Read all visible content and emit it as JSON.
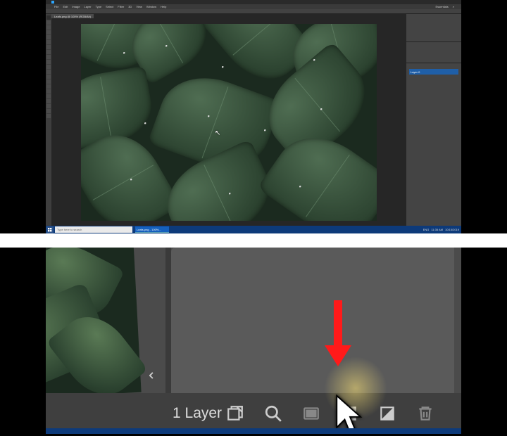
{
  "app": {
    "menus": [
      "File",
      "Edit",
      "Image",
      "Layer",
      "Type",
      "Select",
      "Filter",
      "3D",
      "View",
      "Window",
      "Help"
    ],
    "right_menus": [
      "Essentials"
    ],
    "doc_tab": "Leafs.png @ 100% (RGB/8#)"
  },
  "layers_panel": {
    "active_layer": "Layer 0"
  },
  "taskbar": {
    "search_placeholder": "Type here to search",
    "app_button": "Leafs.png - 100%...",
    "time": "11:35 AM",
    "date": "10/15/2019",
    "lang": "ENG"
  },
  "detail": {
    "layer_count_label": "1 Layer",
    "icons": {
      "link": "link-layers-icon",
      "search": "zoom-icon",
      "fx": "layer-style-icon",
      "mask": "add-mask-icon",
      "new_fill": "new-fill-adjustment-icon",
      "new_layer": "new-layer-icon",
      "trash": "delete-layer-icon"
    }
  }
}
